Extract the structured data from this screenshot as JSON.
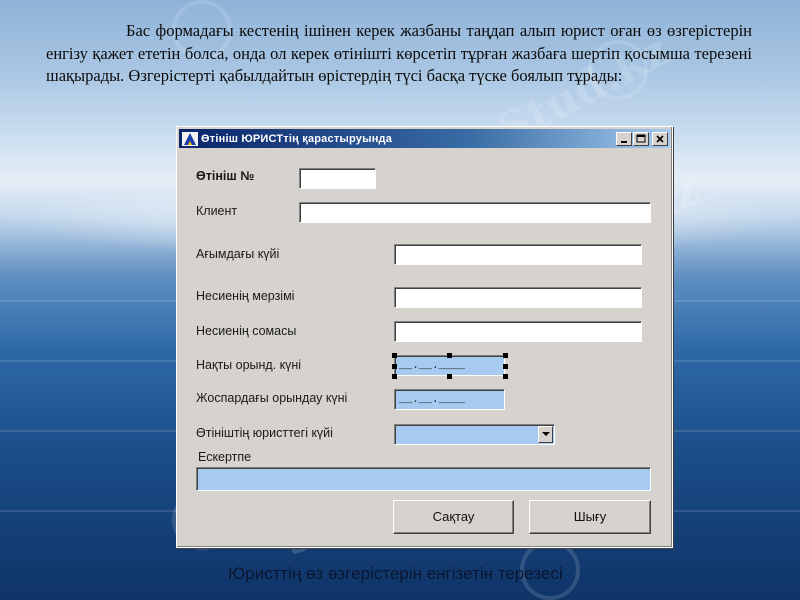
{
  "slide": {
    "intro_text": "Бас формадағы кестенің ішінен керек жазбаны таңдап алып юрист оған өз өзгерістерін енгізу қажет ететін болса, онда ол керек өтінішті көрсетіп тұрған жазбаға шертіп қосымша терезені шақырады. Өзгерістерті қабылдайтын өрістердің түсі басқа түске боялып тұрады:",
    "caption": "Юристтің  өз  өзгерістерін енгізетін терезесі",
    "watermark": "Stud.kz - Stud.kz"
  },
  "window": {
    "title": "Өтініш ЮРИСТтің қарастыруында",
    "icon": "app-triangle-icon",
    "controls": {
      "minimize": "minimize-icon",
      "maximize": "maximize-icon",
      "close": "close-icon"
    }
  },
  "form": {
    "app_no_label": "Өтініш №",
    "app_no_value": "",
    "client_label": "Клиент",
    "client_value": "",
    "current_state_label": "Ағымдағы күйі",
    "current_state_value": "",
    "loan_term_label": "Несиенің мерзімі",
    "loan_term_value": "",
    "loan_amount_label": "Несиенің сомасы",
    "loan_amount_value": "",
    "actual_date_label": "Нақты орынд. күні",
    "actual_date_mask": "__.__.____",
    "planned_date_label": "Жоспардағы орындау күні",
    "planned_date_mask": "__.__.____",
    "lawyer_state_label": "Өтініштің юристтегі күйі",
    "lawyer_state_value": "",
    "note_label": "Ескертпе",
    "note_value": ""
  },
  "buttons": {
    "save": "Сақтау",
    "exit": "Шығу"
  },
  "colors": {
    "editable_field": "#a6caf0",
    "window_face": "#d6d3ce",
    "title_gradient_start": "#0a246a",
    "title_gradient_end": "#a6caf0"
  }
}
